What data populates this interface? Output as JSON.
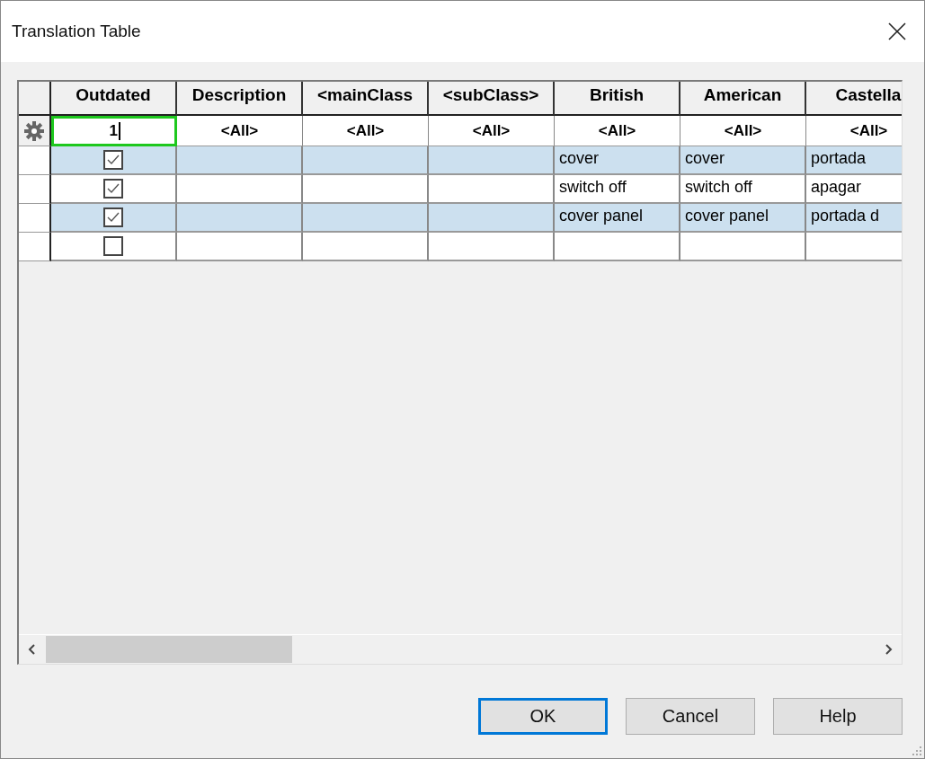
{
  "window": {
    "title": "Translation Table"
  },
  "table": {
    "columns": [
      "Outdated",
      "Description",
      "<mainClass",
      "<subClass>",
      "British",
      "American",
      "Castella"
    ],
    "filters": [
      {
        "value": "1",
        "focused": true
      },
      {
        "value": "<All>",
        "focused": false
      },
      {
        "value": "<All>",
        "focused": false
      },
      {
        "value": "<All>",
        "focused": false
      },
      {
        "value": "<All>",
        "focused": false
      },
      {
        "value": "<All>",
        "focused": false
      },
      {
        "value": "<All>",
        "focused": false
      }
    ],
    "rows": [
      {
        "selected": true,
        "outdated": true,
        "cells": [
          "cover",
          "cover",
          "portada"
        ]
      },
      {
        "selected": false,
        "outdated": true,
        "cells": [
          "switch off",
          "switch off",
          "apagar"
        ]
      },
      {
        "selected": true,
        "outdated": true,
        "cells": [
          "cover panel",
          "cover panel",
          "portada d"
        ]
      },
      {
        "selected": false,
        "outdated": false
      }
    ]
  },
  "buttons": [
    {
      "label": "OK",
      "default": true
    },
    {
      "label": "Cancel",
      "default": false
    },
    {
      "label": "Help",
      "default": false
    }
  ]
}
